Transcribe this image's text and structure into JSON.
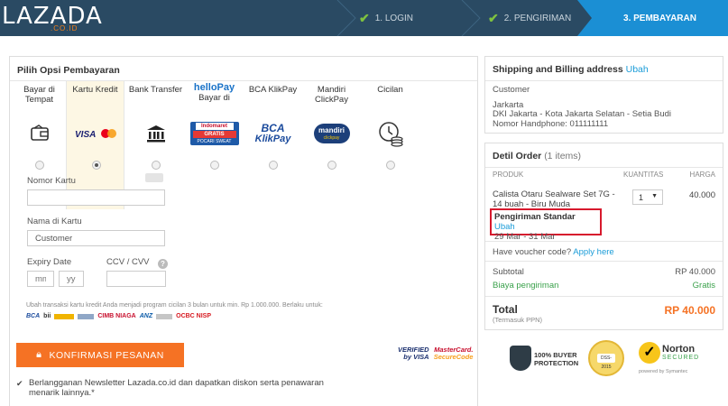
{
  "header": {
    "logo": "LAZADA",
    "logo_sub": ".CO.ID",
    "steps": [
      {
        "label": "1. LOGIN",
        "state": "done"
      },
      {
        "label": "2. PENGIRIMAN",
        "state": "done"
      },
      {
        "label": "3. PEMBAYARAN",
        "state": "active"
      }
    ]
  },
  "payment": {
    "title": "Pilih Opsi Pembayaran",
    "options": [
      {
        "label": "Bayar di Tempat",
        "icon": "wallet-icon",
        "selected": false
      },
      {
        "label": "Kartu Kredit",
        "icon": "visa-mastercard-icon",
        "selected": true
      },
      {
        "label": "Bank Transfer",
        "icon": "bank-icon",
        "selected": false
      },
      {
        "label": "Bayar di",
        "icon": "hellopay-icon",
        "selected": false,
        "brand": "helloPay",
        "promo": "GRATIS",
        "promo_sub": "POCARI SWEAT",
        "store": "Indomaret"
      },
      {
        "label": "BCA KlikPay",
        "icon": "bca-klikpay-icon",
        "selected": false,
        "brand_line1": "BCA",
        "brand_line2": "KlikPay"
      },
      {
        "label": "Mandiri ClickPay",
        "icon": "mandiri-clickpay-icon",
        "selected": false,
        "brand": "mandiri",
        "brand_sub": "clickpay"
      },
      {
        "label": "Cicilan",
        "icon": "installment-icon",
        "selected": false
      }
    ],
    "form": {
      "card_number_label": "Nomor Kartu",
      "card_number_value": "",
      "name_label": "Nama di Kartu",
      "name_value": "Customer",
      "expiry_label": "Expiry Date",
      "expiry_mm_placeholder": "mm",
      "expiry_yy_placeholder": "yy",
      "cvv_label": "CCV / CVV",
      "cvv_help": "?",
      "cvv_value": ""
    },
    "installment_note": "Ubah transaksi kartu kredit Anda menjadi program cicilan 3 bulan untuk min. Rp 1.000.000. Berlaku untuk:",
    "banks": [
      "BCA",
      "bii",
      "CIMB NIAGA",
      "ANZ",
      "OCBC NISP"
    ],
    "confirm_label": "KONFIRMASI PESANAN",
    "verified_line1": "VERIFIED",
    "verified_line2": "by VISA",
    "mastercard_line1": "MasterCard.",
    "mastercard_line2": "SecureCode",
    "newsletter_checked": true,
    "newsletter_text": "Berlangganan Newsletter Lazada.co.id dan dapatkan diskon serta penawaran menarik lainnya.*"
  },
  "shipping": {
    "title": "Shipping and Billing address",
    "edit": "Ubah",
    "name": "Customer",
    "city": "Jarkarta",
    "area": "DKI Jakarta - Kota Jakarta Selatan - Setia Budi",
    "phone": "Nomor Handphone: 011111111"
  },
  "order": {
    "title": "Detil Order",
    "count": "(1 items)",
    "col_product": "PRODUK",
    "col_qty": "KUANTITAS",
    "col_price": "HARGA",
    "item_name": "Calista Otaru Sealware Set 7G - 14 buah - Biru Muda",
    "item_qty": "1",
    "item_price": "40.000",
    "shipping_method": "Pengiriman Standar",
    "shipping_edit": "Ubah",
    "shipping_date": "29 Mar - 31 Mar",
    "voucher_text": "Have voucher code?",
    "voucher_link": "Apply here",
    "subtotal_label": "Subtotal",
    "subtotal_value": "RP 40.000",
    "shipping_cost_label": "Biaya pengiriman",
    "shipping_cost_value": "Gratis",
    "total_label": "Total",
    "total_note": "(Termasuk PPN)",
    "total_value": "RP 40.000"
  },
  "badges": {
    "buyer_protection_line1": "100% BUYER",
    "buyer_protection_line2": "PROTECTION",
    "dss_text": "DSS-2015",
    "norton_name": "Norton",
    "norton_secured": "SECURED",
    "norton_powered": "powered by Symantec"
  },
  "colors": {
    "header_bg": "#2a4a63",
    "active_step": "#1b8fd4",
    "accent_orange": "#f57224",
    "link_blue": "#1a9cd8",
    "highlight_red": "#d7192d",
    "success_green": "#3aa14b"
  }
}
